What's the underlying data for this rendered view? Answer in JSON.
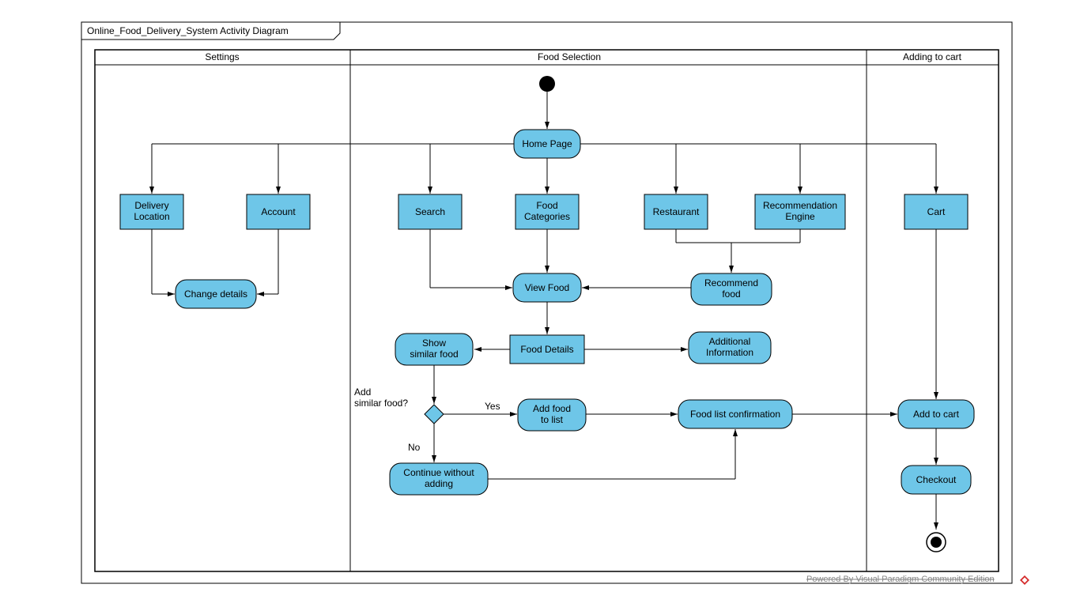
{
  "diagram": {
    "title": "Online_Food_Delivery_System Activity Diagram",
    "lanes": {
      "settings": "Settings",
      "foodSelection": "Food Selection",
      "addingToCart": "Adding to cart"
    },
    "nodes": {
      "homePage": "Home Page",
      "deliveryLocation": "Delivery\nLocation",
      "account": "Account",
      "search": "Search",
      "foodCategories": "Food\nCategories",
      "restaurant": "Restaurant",
      "recommendationEngine": "Recommendation\nEngine",
      "cart": "Cart",
      "changeDetails": "Change details",
      "viewFood": "View Food",
      "recommendFood": "Recommend\nfood",
      "foodDetails": "Food Details",
      "showSimilarFood": "Show\nsimilar food",
      "additionalInformation": "Additional\nInformation",
      "addFoodToList": "Add food\nto list",
      "foodListConfirmation": "Food list confirmation",
      "continueWithoutAdding": "Continue without\nadding",
      "addToCart": "Add to cart",
      "checkout": "Checkout"
    },
    "labels": {
      "decisionQuestion": "Add\nsimilar food?",
      "yes": "Yes",
      "no": "No"
    },
    "watermark": "Powered By   Visual Paradigm Community Edition"
  }
}
